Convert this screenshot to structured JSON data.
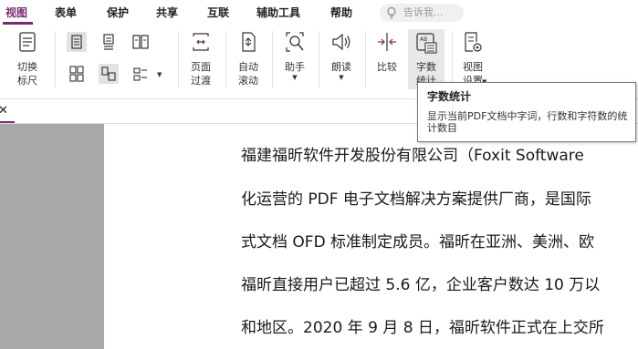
{
  "menu": {
    "items": [
      "视图",
      "表单",
      "保护",
      "共享",
      "互联",
      "辅助工具",
      "帮助"
    ],
    "active": "视图"
  },
  "search": {
    "placeholder": "告诉我..."
  },
  "ribbon": {
    "switch_sidebar": "切换\n标尺",
    "switch_l1": "切换",
    "switch_l2": "标尺",
    "page_transition_l1": "页面",
    "page_transition_l2": "过渡",
    "autoscroll_l1": "自动",
    "autoscroll_l2": "滚动",
    "assistant": "助手",
    "read_aloud": "朗读",
    "compare": "比较",
    "word_count_l1": "字数",
    "word_count_l2": "统计",
    "view_settings_l1": "视图",
    "view_settings_l2": "设置"
  },
  "tooltip": {
    "title": "字数统计",
    "body": "显示当前PDF文档中字词，行数和字符数的统计数目"
  },
  "document": {
    "lines": [
      "福建福昕软件开发股份有限公司（Foxit Software",
      "化运营的 PDF 电子文档解决方案提供厂商，是国际",
      "式文档 OFD 标准制定成员。福昕在亚洲、美洲、欧",
      "福昕直接用户已超过 5.6 亿，企业客户数达 10 万以",
      "和地区。2020 年 9 月 8 日，福昕软件正式在上交所"
    ]
  },
  "colors": {
    "accent": "#7a2a6e",
    "grey_pane": "#a8a8a8"
  }
}
